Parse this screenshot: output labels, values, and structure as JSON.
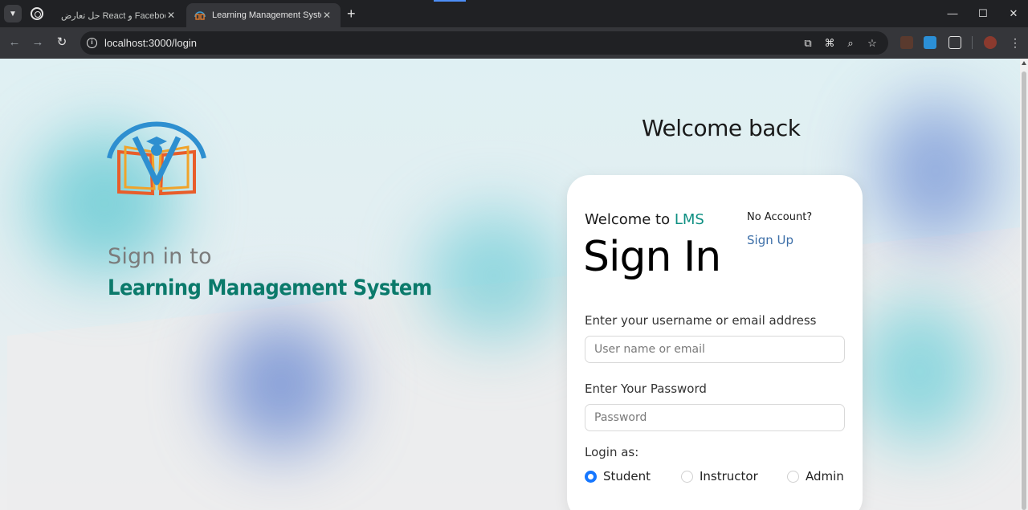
{
  "browser": {
    "tabs": [
      {
        "title": "حل تعارض React و Facebook",
        "active": false
      },
      {
        "title": "Learning Management System",
        "active": true
      }
    ],
    "url": "localhost:3000/login"
  },
  "page": {
    "sign_in_to": "Sign in to",
    "system_name": "Learning Management System",
    "welcome_back": "Welcome back",
    "card": {
      "welcome_prefix": "Welcome to ",
      "brand": "LMS",
      "title": "Sign In",
      "no_account": "No Account?",
      "signup_link": "Sign Up",
      "username_label": "Enter your username or email address",
      "username_placeholder": "User name or email",
      "password_label": "Enter Your Password",
      "password_placeholder": "Password",
      "login_as_label": "Login as:",
      "roles": [
        {
          "label": "Student",
          "checked": true
        },
        {
          "label": "Instructor",
          "checked": false
        },
        {
          "label": "Admin",
          "checked": false
        }
      ]
    }
  },
  "colors": {
    "brand_teal": "#0b7a6b",
    "link_blue": "#3d6fa8",
    "radio_blue": "#1677ff"
  }
}
